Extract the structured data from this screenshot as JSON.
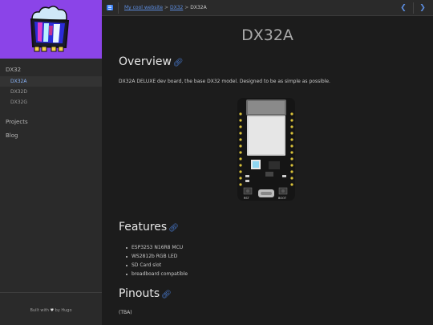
{
  "site": {
    "footer_prefix": "Built with",
    "footer_suffix": "by Hugo"
  },
  "sidebar": {
    "section": "DX32",
    "sub_items": [
      {
        "label": "DX32A",
        "active": true
      },
      {
        "label": "DX32D",
        "active": false
      },
      {
        "label": "DX32G",
        "active": false
      }
    ],
    "items": [
      {
        "label": "Projects"
      },
      {
        "label": "Blog"
      }
    ]
  },
  "topbar": {
    "menu_icon": "menu-icon",
    "breadcrumb": [
      "My cool website",
      "DX32",
      "DX32A"
    ],
    "separator": ">",
    "prev_icon": "chevron-left-icon",
    "next_icon": "chevron-right-icon"
  },
  "page": {
    "title": "DX32A",
    "sections": {
      "overview": "Overview",
      "features": "Features",
      "pinouts": "Pinouts"
    },
    "intro": "DX32A DELUXE dev board, the base DX32 model. Designed to be as simple as possible.",
    "features": [
      "ESP32S3 N16R8 MCU",
      "WS2812b RGB LED",
      "SD Card slot",
      "breadboard compatible"
    ],
    "pinouts_text": "(TBA)",
    "board_labels": {
      "reset": "RST",
      "boot": "BOOT"
    }
  },
  "colors": {
    "accent": "#5c8de0",
    "logo_bg": "#8b44e8",
    "sidebar_bg": "#2a2a2a",
    "main_bg": "#1c1c1c"
  }
}
